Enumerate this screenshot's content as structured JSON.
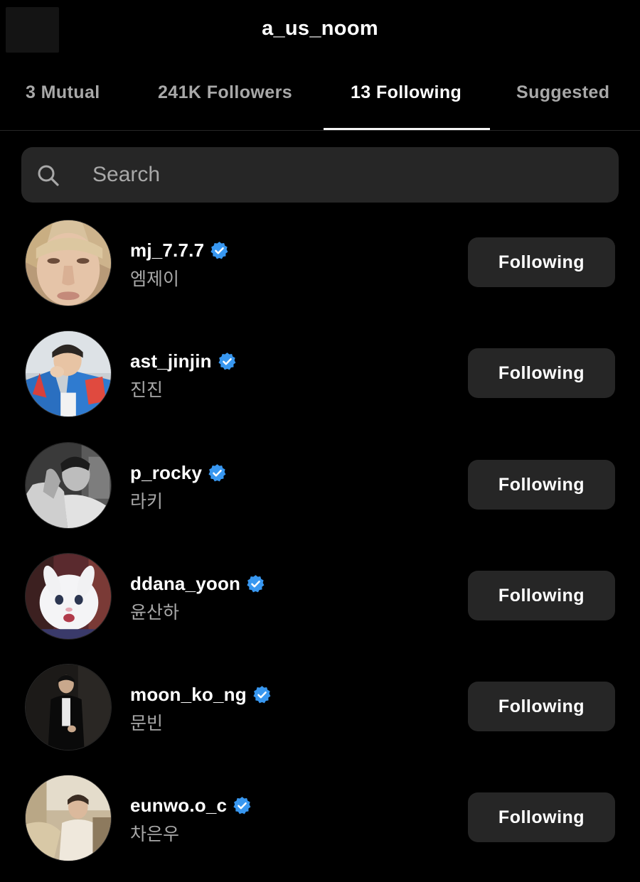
{
  "header": {
    "title": "a_us_noom"
  },
  "tabs": [
    {
      "label": "3 Mutual"
    },
    {
      "label": "241K Followers"
    },
    {
      "label": "13 Following"
    },
    {
      "label": "Suggested"
    }
  ],
  "active_tab": "13 Following",
  "search": {
    "placeholder": "Search",
    "value": ""
  },
  "colors": {
    "background": "#000000",
    "button": "#262626",
    "verified": "#3897f0",
    "secondary_text": "#a8a8a8"
  },
  "users": [
    {
      "username": "mj_7.7.7",
      "name": "엠제이",
      "button": "Following",
      "verified": true
    },
    {
      "username": "ast_jinjin",
      "name": "진진",
      "button": "Following",
      "verified": true
    },
    {
      "username": "p_rocky",
      "name": "라키",
      "button": "Following",
      "verified": true
    },
    {
      "username": "ddana_yoon",
      "name": "윤산하",
      "button": "Following",
      "verified": true
    },
    {
      "username": "moon_ko_ng",
      "name": "문빈",
      "button": "Following",
      "verified": true
    },
    {
      "username": "eunwo.o_c",
      "name": "차은우",
      "button": "Following",
      "verified": true
    }
  ]
}
